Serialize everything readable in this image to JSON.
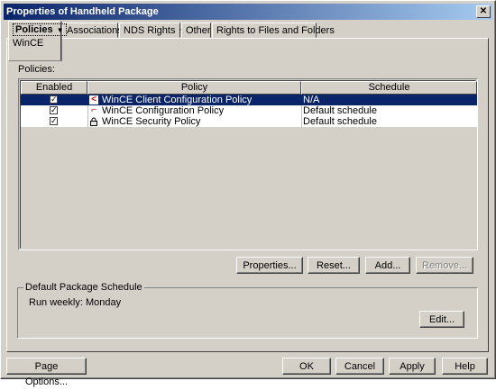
{
  "window": {
    "title": "Properties of Handheld Package",
    "close_glyph": "✕"
  },
  "tabs": [
    {
      "label": "Policies",
      "sub": "WinCE",
      "has_menu": true,
      "active": true
    },
    {
      "label": "Associations"
    },
    {
      "label": "NDS Rights",
      "has_menu": true
    },
    {
      "label": "Other"
    },
    {
      "label": "Rights to Files and Folders"
    }
  ],
  "tab_arrow": "▼",
  "policies_label": "Policies:",
  "table": {
    "columns": [
      "Enabled",
      "Policy",
      "Schedule"
    ],
    "rows": [
      {
        "enabled": true,
        "icon": "wince-client-config-icon",
        "policy": "WinCE Client Configuration Policy",
        "schedule": "N/A",
        "selected": true
      },
      {
        "enabled": true,
        "icon": "wince-config-icon",
        "policy": "WinCE Configuration Policy",
        "schedule": "Default schedule",
        "selected": false
      },
      {
        "enabled": true,
        "icon": "lock-icon",
        "policy": "WinCE Security Policy",
        "schedule": "Default schedule",
        "selected": false
      }
    ]
  },
  "policy_buttons": {
    "properties": "Properties...",
    "reset": "Reset...",
    "add": "Add...",
    "remove": "Remove..."
  },
  "schedule_group": {
    "label": "Default Package Schedule",
    "text": "Run weekly: Monday",
    "edit": "Edit..."
  },
  "footer": {
    "page_options": "Page Options...",
    "ok": "OK",
    "cancel": "Cancel",
    "apply": "Apply",
    "help": "Help"
  },
  "colors": {
    "selection": "#0a246a",
    "titlebar": "#0a246a",
    "face": "#d4d0c8"
  }
}
